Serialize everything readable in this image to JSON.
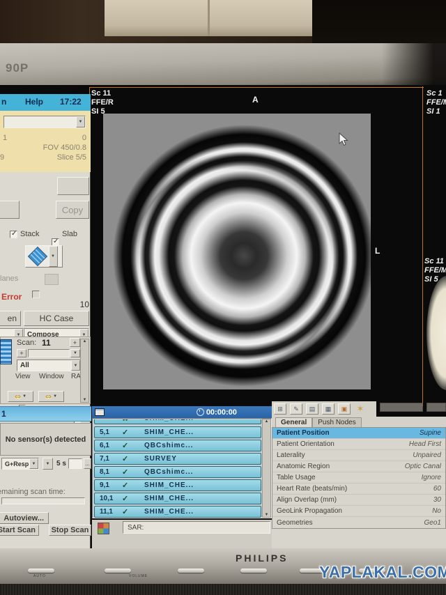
{
  "monitor": {
    "model": "90P",
    "brand": "PHILIPS",
    "watermark": "YAPLAKAL.COM",
    "buttons": {
      "auto": "AUTO",
      "volume": "VOLUME"
    }
  },
  "menubar": {
    "partial_item": "n",
    "help": "Help",
    "time": "17:22"
  },
  "fov_panel": {
    "top_left": "1",
    "top_right": "0",
    "fov": "FOV 450/0.8",
    "bottom_left": "9",
    "slice": "Slice 5/5"
  },
  "controls": {
    "copy": "Copy",
    "stack": "Stack",
    "slab": "Slab",
    "planes_partial": "lanes",
    "error": "Error",
    "error_value": "10",
    "open_partial": "en",
    "hc_case": "HC Case",
    "compose": "Compose",
    "scan_label": "Scan:",
    "scan_value": "11",
    "plus": "+",
    "all": "All",
    "view": "View",
    "window": "Window",
    "ral": "RAL",
    "exam_row_partial": "1",
    "no_sensor": "No sensor(s) detected",
    "trigger": "G+Resp",
    "interval": "5 s",
    "ellipsis": "...",
    "remaining_partial": "emaining scan time:",
    "autoview": "Autoview...",
    "start_scan": "Start Scan",
    "stop_scan": "Stop Scan"
  },
  "viewport": {
    "main": {
      "scan": "Sc 11",
      "sequence": "FFE/R",
      "slice": "SI 5"
    },
    "marker_top": "A",
    "marker_right": "L",
    "right_top": {
      "scan": "Sc 1",
      "sequence": "FFE/M",
      "slice": "SI 1"
    },
    "right_mid": {
      "scan": "Sc 11",
      "sequence": "FFE/M",
      "slice": "SI 5"
    }
  },
  "scanlist": {
    "timer": "00:00:00",
    "check_glyph": "✓",
    "failed_glyph": "✖",
    "partial_row_name": "SHIM_CHE...",
    "rows": [
      {
        "id": "5,1",
        "name": "SHIM_CHE..."
      },
      {
        "id": "6,1",
        "name": "QBCshimc..."
      },
      {
        "id": "7,1",
        "name": "SURVEY"
      },
      {
        "id": "8,1",
        "name": "QBCshimc..."
      },
      {
        "id": "9,1",
        "name": "SHIM_CHE..."
      },
      {
        "id": "10,1",
        "name": "SHIM_CHE..."
      },
      {
        "id": "11,1",
        "name": "SHIM_CHE..."
      }
    ],
    "sar_label": "SAR:"
  },
  "patient_panel": {
    "toolbar_icons": [
      {
        "name": "layout-icon",
        "glyph": "⊞"
      },
      {
        "name": "edit-note-icon",
        "glyph": "✎"
      },
      {
        "name": "grid-pair-icon",
        "glyph": "▤"
      },
      {
        "name": "grid-detail-icon",
        "glyph": "▦"
      },
      {
        "name": "patient-card-icon",
        "glyph": "▣"
      },
      {
        "name": "star-annotate-icon",
        "glyph": "✶"
      }
    ],
    "tabs": {
      "general": "General",
      "push_nodes": "Push Nodes"
    },
    "rows": [
      {
        "label": "Patient Position",
        "value": "Supine"
      },
      {
        "label": "Patient Orientation",
        "value": "Head First"
      },
      {
        "label": "Laterality",
        "value": "Unpaired"
      },
      {
        "label": "Anatomic Region",
        "value": "Optic Canal"
      },
      {
        "label": "Table Usage",
        "value": "Ignore"
      },
      {
        "label": "Heart Rate (beats/min)",
        "value": "60"
      },
      {
        "label": "Align Overlap (mm)",
        "value": "30"
      },
      {
        "label": "GeoLink Propagation",
        "value": "No"
      },
      {
        "label": "Geometries",
        "value": "Geo1"
      }
    ]
  },
  "colors": {
    "viewport_border": "#c0761c",
    "row_teal": "#8ccfe0",
    "titlebar_blue": "#2e6cb4",
    "menubar_cyan": "#45b3d8",
    "highlight_blue": "#68b8e2",
    "error_red": "#c43a2e"
  }
}
